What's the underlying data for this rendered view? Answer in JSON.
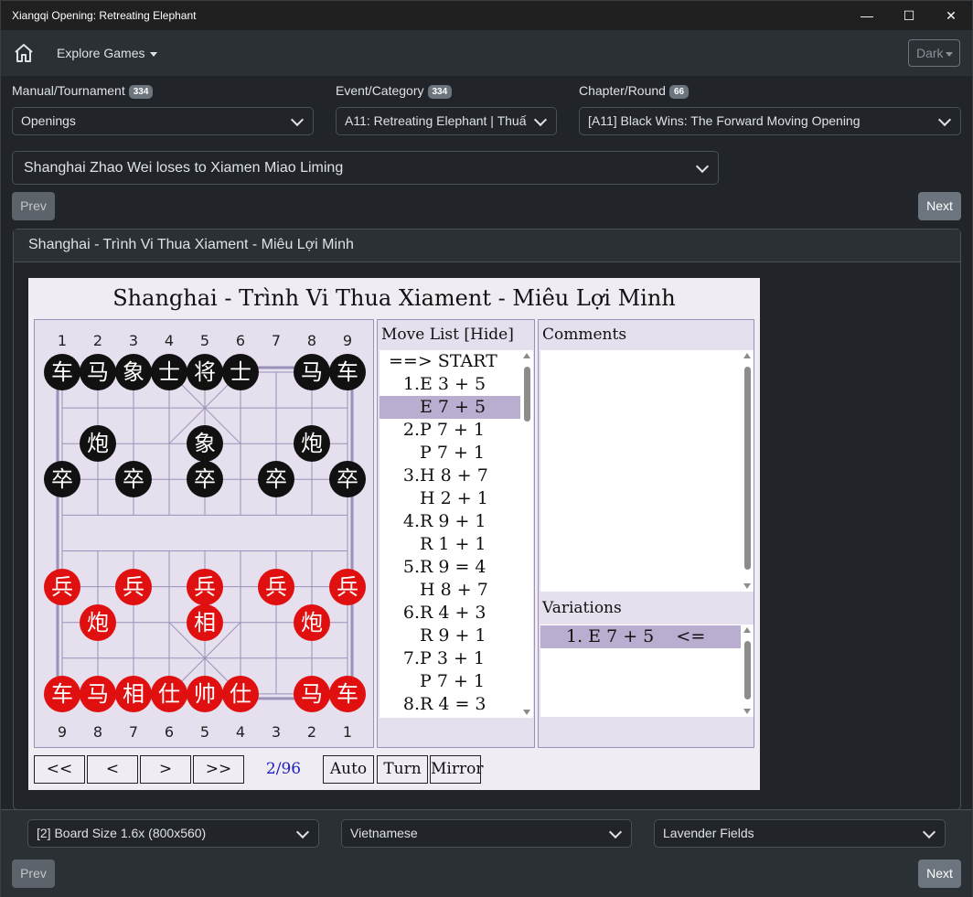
{
  "window": {
    "title": "Xiangqi Opening: Retreating Elephant"
  },
  "nav": {
    "explore": "Explore Games",
    "theme": "Dark"
  },
  "filters": [
    {
      "label": "Manual/Tournament",
      "count": "334",
      "value": "Openings"
    },
    {
      "label": "Event/Category",
      "count": "334",
      "value": "A11: Retreating Elephant | Thuấ"
    },
    {
      "label": "Chapter/Round",
      "count": "66",
      "value": "[A11] Black Wins: The Forward Moving Opening"
    }
  ],
  "game_select": "Shanghai Zhao Wei loses to Xiamen Miao Liming",
  "prev_label": "Prev",
  "next_label": "Next",
  "card_title": "Shanghai - Trình Vi Thua Xiament - Miêu Lợi Minh",
  "viewer": {
    "title": "Shanghai - Trình Vi Thua Xiament - Miêu Lợi Minh",
    "top_numbers": [
      "1",
      "2",
      "3",
      "4",
      "5",
      "6",
      "7",
      "8",
      "9"
    ],
    "bottom_numbers": [
      "9",
      "8",
      "7",
      "6",
      "5",
      "4",
      "3",
      "2",
      "1"
    ],
    "pieces": [
      {
        "char": "车",
        "color": "black",
        "col": 0,
        "row": 0
      },
      {
        "char": "马",
        "color": "black",
        "col": 1,
        "row": 0
      },
      {
        "char": "象",
        "color": "black",
        "col": 2,
        "row": 0
      },
      {
        "char": "士",
        "color": "black",
        "col": 3,
        "row": 0
      },
      {
        "char": "将",
        "color": "black",
        "col": 4,
        "row": 0
      },
      {
        "char": "士",
        "color": "black",
        "col": 5,
        "row": 0
      },
      {
        "char": "马",
        "color": "black",
        "col": 7,
        "row": 0
      },
      {
        "char": "车",
        "color": "black",
        "col": 8,
        "row": 0
      },
      {
        "char": "炮",
        "color": "black",
        "col": 1,
        "row": 2
      },
      {
        "char": "象",
        "color": "black",
        "col": 4,
        "row": 2
      },
      {
        "char": "炮",
        "color": "black",
        "col": 7,
        "row": 2
      },
      {
        "char": "卒",
        "color": "black",
        "col": 0,
        "row": 3
      },
      {
        "char": "卒",
        "color": "black",
        "col": 2,
        "row": 3
      },
      {
        "char": "卒",
        "color": "black",
        "col": 4,
        "row": 3
      },
      {
        "char": "卒",
        "color": "black",
        "col": 6,
        "row": 3
      },
      {
        "char": "卒",
        "color": "black",
        "col": 8,
        "row": 3
      },
      {
        "char": "兵",
        "color": "red",
        "col": 0,
        "row": 6
      },
      {
        "char": "兵",
        "color": "red",
        "col": 2,
        "row": 6
      },
      {
        "char": "兵",
        "color": "red",
        "col": 4,
        "row": 6
      },
      {
        "char": "兵",
        "color": "red",
        "col": 6,
        "row": 6
      },
      {
        "char": "兵",
        "color": "red",
        "col": 8,
        "row": 6
      },
      {
        "char": "炮",
        "color": "red",
        "col": 1,
        "row": 7
      },
      {
        "char": "相",
        "color": "red",
        "col": 4,
        "row": 7
      },
      {
        "char": "炮",
        "color": "red",
        "col": 7,
        "row": 7
      },
      {
        "char": "车",
        "color": "red",
        "col": 0,
        "row": 9
      },
      {
        "char": "马",
        "color": "red",
        "col": 1,
        "row": 9
      },
      {
        "char": "相",
        "color": "red",
        "col": 2,
        "row": 9
      },
      {
        "char": "仕",
        "color": "red",
        "col": 3,
        "row": 9
      },
      {
        "char": "帅",
        "color": "red",
        "col": 4,
        "row": 9
      },
      {
        "char": "仕",
        "color": "red",
        "col": 5,
        "row": 9
      },
      {
        "char": "马",
        "color": "red",
        "col": 7,
        "row": 9
      },
      {
        "char": "车",
        "color": "red",
        "col": 8,
        "row": 9
      }
    ],
    "move_list_title": "Move List [Hide]",
    "moves": [
      {
        "num": "",
        "text": "==> START",
        "selected": false
      },
      {
        "num": "1.",
        "text": "E 3 + 5",
        "selected": false
      },
      {
        "num": "",
        "text": "E 7 + 5",
        "selected": true
      },
      {
        "num": "2.",
        "text": "P 7 + 1",
        "selected": false
      },
      {
        "num": "",
        "text": "P 7 + 1",
        "selected": false
      },
      {
        "num": "3.",
        "text": "H 8 + 7",
        "selected": false
      },
      {
        "num": "",
        "text": "H 2 + 1",
        "selected": false
      },
      {
        "num": "4.",
        "text": "R 9 + 1",
        "selected": false
      },
      {
        "num": "",
        "text": "R 1 + 1",
        "selected": false
      },
      {
        "num": "5.",
        "text": "R 9 = 4",
        "selected": false
      },
      {
        "num": "",
        "text": "H 8 + 7",
        "selected": false
      },
      {
        "num": "6.",
        "text": "R 4 + 3",
        "selected": false
      },
      {
        "num": "",
        "text": "R 9 + 1",
        "selected": false
      },
      {
        "num": "7.",
        "text": "P 3 + 1",
        "selected": false
      },
      {
        "num": "",
        "text": "P 7 + 1",
        "selected": false
      },
      {
        "num": "8.",
        "text": "R 4 = 3",
        "selected": false
      }
    ],
    "comments_title": "Comments",
    "variations_title": "Variations",
    "variation": "1. E 7 + 5    <=",
    "controls": {
      "first": "<<",
      "prev": "<",
      "next": ">",
      "last": ">>",
      "position": "2/96",
      "auto": "Auto",
      "turn": "Turn",
      "mirror": "Mirror"
    }
  },
  "footer": {
    "board_size": "[2] Board Size 1.6x (800x560)",
    "language": "Vietnamese",
    "theme": "Lavender Fields"
  },
  "colors": {
    "selected_move": "#b9add0",
    "board_line": "#9a90b8",
    "red_piece": "#e01010",
    "black_piece": "#111111"
  }
}
